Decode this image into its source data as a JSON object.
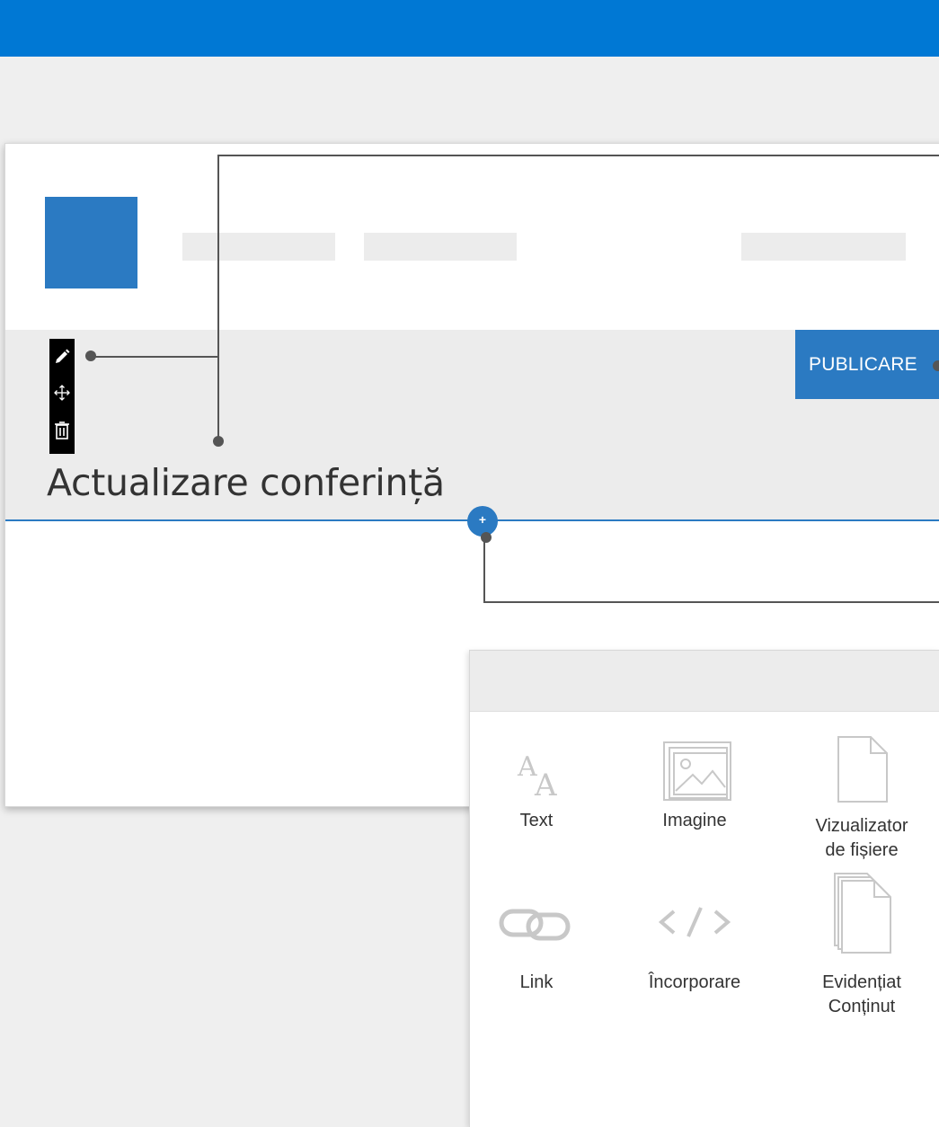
{
  "colors": {
    "brand_blue": "#0078d4",
    "accent_blue": "#2b7ac2",
    "panel_gray": "#ececec",
    "background": "#efefef"
  },
  "toolbar": {
    "publish_label": "PUBLICARE",
    "tools": [
      {
        "icon": "pencil-icon"
      },
      {
        "icon": "move-icon"
      },
      {
        "icon": "trash-icon"
      }
    ]
  },
  "page": {
    "title": "Actualizare conferință",
    "add_label": "+"
  },
  "picker": {
    "items": [
      {
        "label": "Text",
        "icon": "text-icon"
      },
      {
        "label": "Imagine",
        "icon": "image-icon"
      },
      {
        "label": "Vizualizator\nde fișiere",
        "icon": "file-icon"
      },
      {
        "label": "Link",
        "icon": "link-icon"
      },
      {
        "label": "Încorporare",
        "icon": "embed-icon"
      },
      {
        "label": "Evidențiat\nConținut",
        "icon": "highlighted-content-icon"
      }
    ]
  }
}
